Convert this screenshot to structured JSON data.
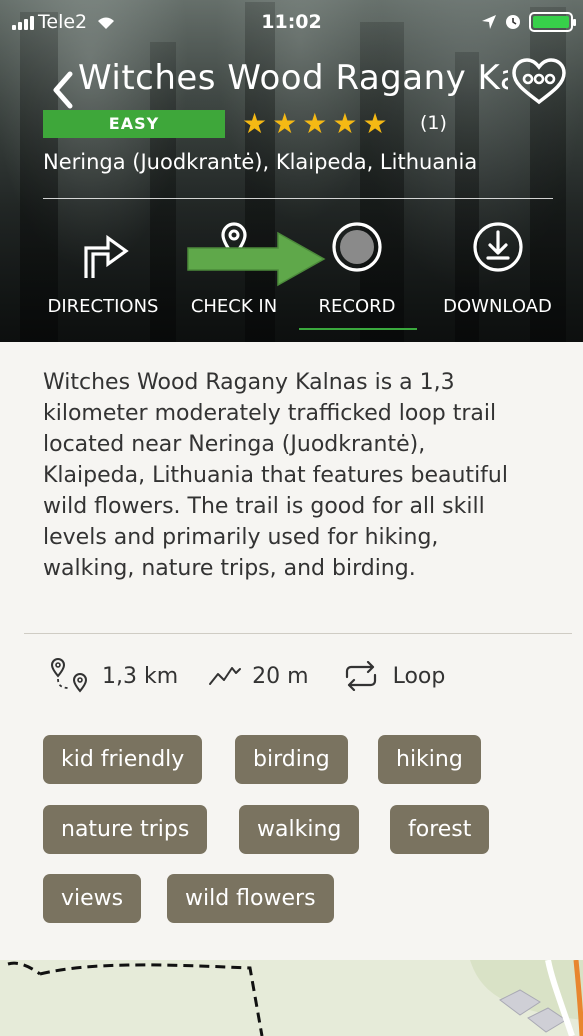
{
  "status_bar": {
    "carrier": "Tele2",
    "time": "11:02"
  },
  "header": {
    "title": "Witches Wood Ragany Ka...",
    "difficulty": "EASY",
    "rating_stars": 5,
    "review_count": "(1)",
    "location": "Neringa (Juodkrantė), Klaipeda, Lithuania"
  },
  "actions": [
    {
      "label": "DIRECTIONS",
      "icon": "directions-turn-icon"
    },
    {
      "label": "CHECK IN",
      "icon": "check-in-pin-icon"
    },
    {
      "label": "RECORD",
      "icon": "record-circle-icon",
      "selected": true
    },
    {
      "label": "DOWNLOAD",
      "icon": "download-icon"
    }
  ],
  "description": "Witches Wood Ragany Kalnas is a 1,3 kilometer moderately trafficked loop trail located near Neringa (Juodkrantė), Klaipeda, Lithuania that features beautiful wild flowers. The trail is good for all skill levels and primarily used for hiking, walking, nature trips, and birding.",
  "description_lines": [
    "Witches Wood Ragany Kalnas is a 1,3",
    "kilometer moderately trafficked loop trail",
    "located near Neringa (Juodkrantė),",
    "Klaipeda, Lithuania that features beautiful",
    "wild flowers. The trail is good for all skill",
    "levels and primarily used for hiking,",
    "walking, nature trips, and birding."
  ],
  "stats": {
    "distance": "1,3 km",
    "elevation": "20 m",
    "route_type": "Loop"
  },
  "tags": [
    "kid friendly",
    "birding",
    "hiking",
    "nature trips",
    "walking",
    "forest",
    "views",
    "wild flowers"
  ],
  "colors": {
    "accent_green": "#3ea73a",
    "star_yellow": "#f5b914",
    "tag_bg": "#7a7360",
    "annotation_arrow": "#5fa84a"
  }
}
